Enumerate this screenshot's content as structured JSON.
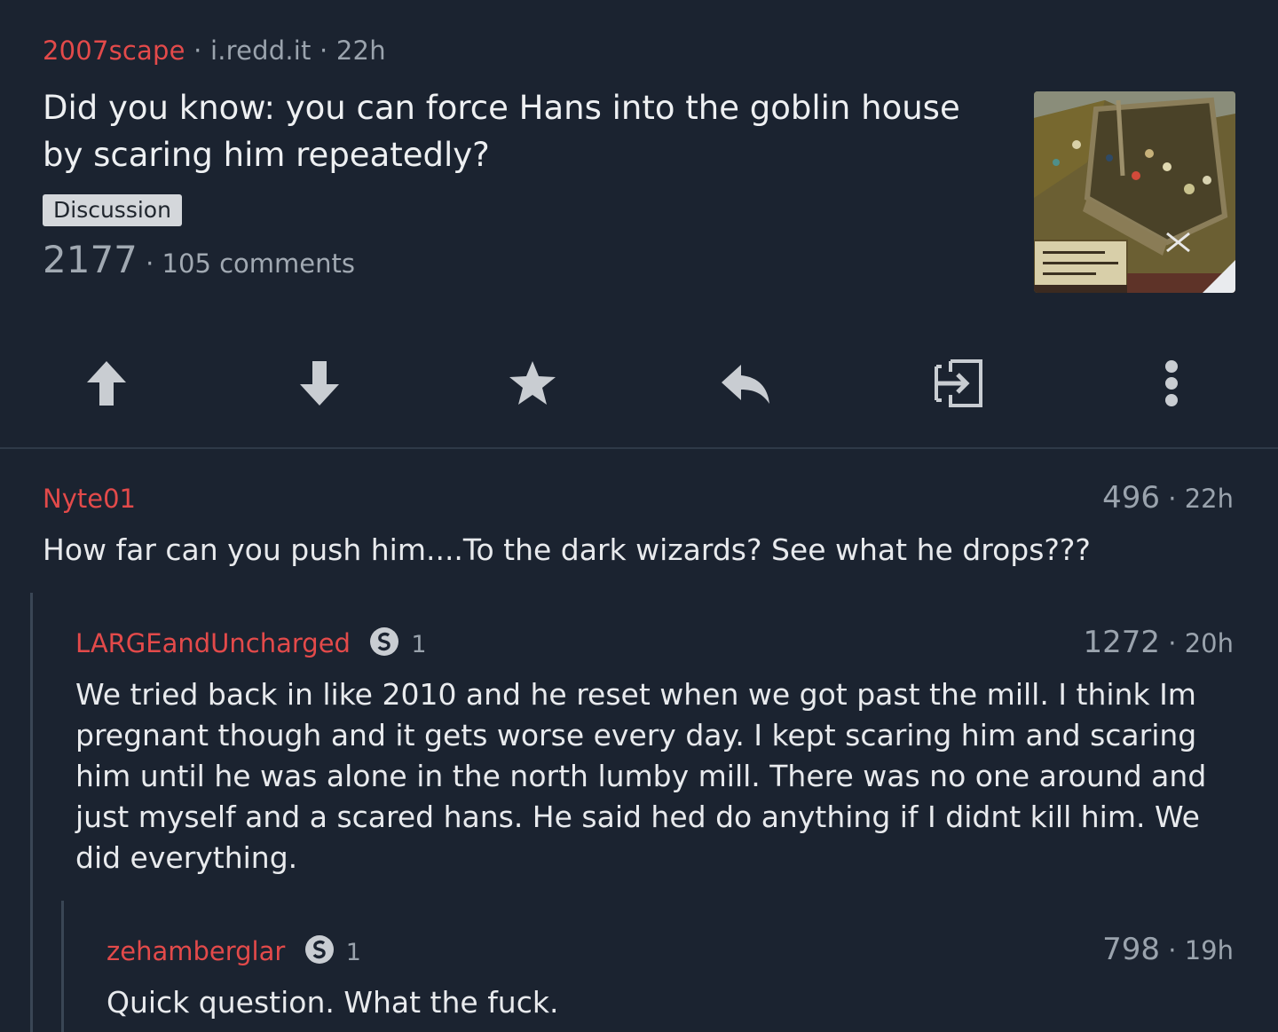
{
  "post": {
    "subreddit": "2007scape",
    "sep1": "·",
    "domain": "i.redd.it",
    "sep2": "·",
    "age": "22h",
    "title": "Did you know: you can force Hans into the goblin house by scaring him repeatedly?",
    "flair": "Discussion",
    "score": "2177",
    "sep3": "·",
    "comments": "105 comments"
  },
  "actions": [
    "upvote-icon",
    "downvote-icon",
    "star-icon",
    "reply-icon",
    "share-icon",
    "more-icon"
  ],
  "comments": [
    {
      "author": "Nyte01",
      "score": "496",
      "sep": "·",
      "age": "22h",
      "body": "How far can you push him....To the dark wizards? See what he drops???"
    },
    {
      "author": "LARGEandUncharged",
      "badge_icon": "s-badge-icon",
      "badge_count": "1",
      "score": "1272",
      "sep": "·",
      "age": "20h",
      "body": "We tried back in like 2010 and he reset when we got past the mill. I think Im pregnant though and it gets worse every day. I kept scaring him and scaring him until he was alone in the north lumby mill. There was no one around and just myself and a scared hans. He said hed do anything if I didnt kill him. We did everything."
    },
    {
      "author": "zehamberglar",
      "badge_icon": "s-badge-icon",
      "badge_count": "1",
      "score": "798",
      "sep": "·",
      "age": "19h",
      "body": "Quick question. What the fuck."
    }
  ],
  "colors": {
    "background": "#1b2330",
    "username": "#e34a4a",
    "muted": "#9aa3ad",
    "icon": "#c9cdd2"
  }
}
